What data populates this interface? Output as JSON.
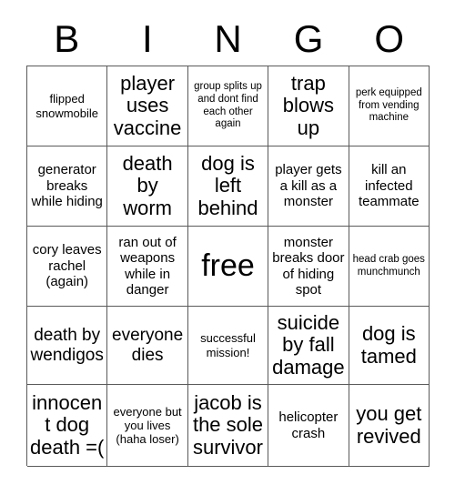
{
  "card": {
    "headers": [
      "B",
      "I",
      "N",
      "G",
      "O"
    ],
    "rows": [
      [
        {
          "text": "flipped snowmobile",
          "size": "sm"
        },
        {
          "text": "player uses vaccine",
          "size": "xl"
        },
        {
          "text": "group splits up and dont find each other again",
          "size": "xs"
        },
        {
          "text": "trap blows up",
          "size": "xl"
        },
        {
          "text": "perk equipped from vending machine",
          "size": "xs"
        }
      ],
      [
        {
          "text": "generator breaks while hiding",
          "size": "md"
        },
        {
          "text": "death by worm",
          "size": "xl"
        },
        {
          "text": "dog is left behind",
          "size": "xl"
        },
        {
          "text": "player gets a kill as a monster",
          "size": "md"
        },
        {
          "text": "kill an infected teammate",
          "size": "md"
        }
      ],
      [
        {
          "text": "cory leaves rachel (again)",
          "size": "md"
        },
        {
          "text": "ran out of weapons while in danger",
          "size": "md"
        },
        {
          "text": "free",
          "size": "xxl"
        },
        {
          "text": "monster breaks door of hiding spot",
          "size": "md"
        },
        {
          "text": "head crab goes munchmunch",
          "size": "xs"
        }
      ],
      [
        {
          "text": "death by wendigos",
          "size": "lg"
        },
        {
          "text": "everyone dies",
          "size": "lg"
        },
        {
          "text": "successful mission!",
          "size": "sm"
        },
        {
          "text": "suicide by fall damage",
          "size": "xl"
        },
        {
          "text": "dog is tamed",
          "size": "xl"
        }
      ],
      [
        {
          "text": "innocent dog death =(",
          "size": "xl"
        },
        {
          "text": "everyone but you lives (haha loser)",
          "size": "sm"
        },
        {
          "text": "jacob is the sole survivor",
          "size": "xl"
        },
        {
          "text": "helicopter crash",
          "size": "md"
        },
        {
          "text": "you get revived",
          "size": "xl"
        }
      ]
    ]
  }
}
